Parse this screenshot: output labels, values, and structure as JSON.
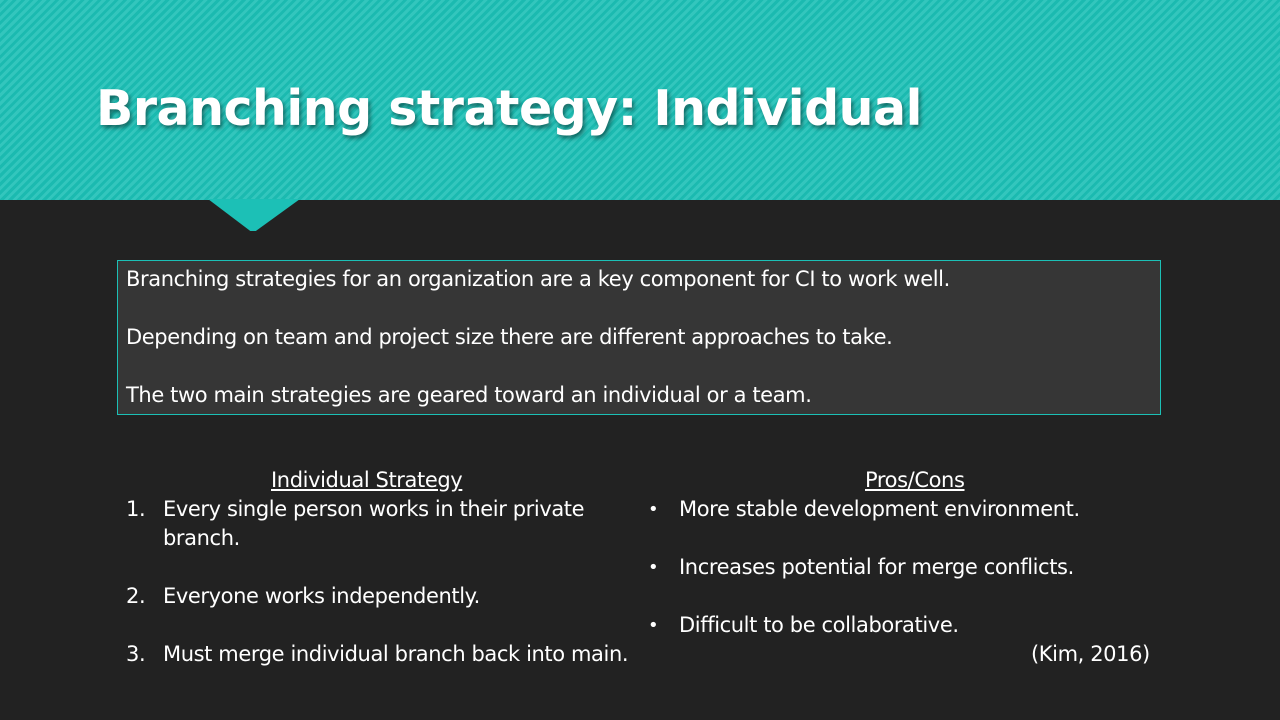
{
  "slide": {
    "title": "Branching strategy: Individual",
    "colors": {
      "accent": "#1cc0b6",
      "background": "#222222",
      "box": "#363636",
      "text": "#ffffff"
    }
  },
  "intro": {
    "lines": [
      "Branching strategies for an organization are a key component for CI to work well.",
      "Depending on team and project size there are different approaches to take.",
      "The two main strategies are geared toward an individual or a team."
    ]
  },
  "strategy": {
    "heading": "Individual Strategy",
    "items": [
      {
        "num": "1.",
        "text": "Every single person works in their private branch."
      },
      {
        "num": "2.",
        "text": "Everyone works independently."
      },
      {
        "num": "3.",
        "text": "Must merge individual branch back into main."
      }
    ]
  },
  "pros_cons": {
    "heading": "Pros/Cons",
    "bullet": "•",
    "items": [
      "More stable development environment.",
      "Increases potential for merge conflicts.",
      "Difficult to be collaborative."
    ],
    "citation": "(Kim, 2016)"
  }
}
